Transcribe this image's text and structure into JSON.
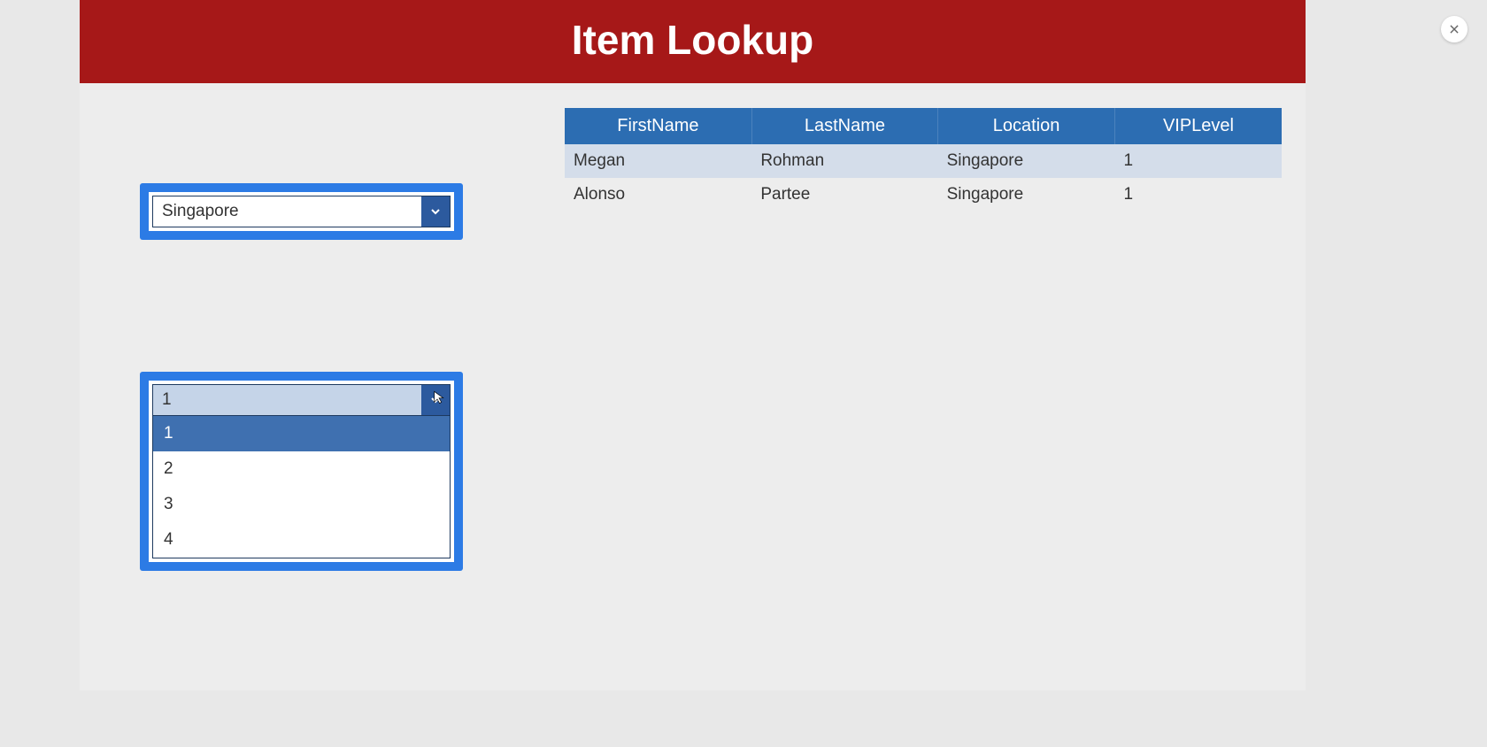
{
  "header": {
    "title": "Item Lookup"
  },
  "filters": {
    "location": {
      "selected": "Singapore"
    },
    "viplevel": {
      "selected": "1",
      "options": [
        "1",
        "2",
        "3",
        "4"
      ],
      "selectedIndex": 0
    }
  },
  "table": {
    "columns": [
      "FirstName",
      "LastName",
      "Location",
      "VIPLevel"
    ],
    "rows": [
      {
        "FirstName": "Megan",
        "LastName": "Rohman",
        "Location": "Singapore",
        "VIPLevel": "1"
      },
      {
        "FirstName": "Alonso",
        "LastName": "Partee",
        "Location": "Singapore",
        "VIPLevel": "1"
      }
    ]
  }
}
